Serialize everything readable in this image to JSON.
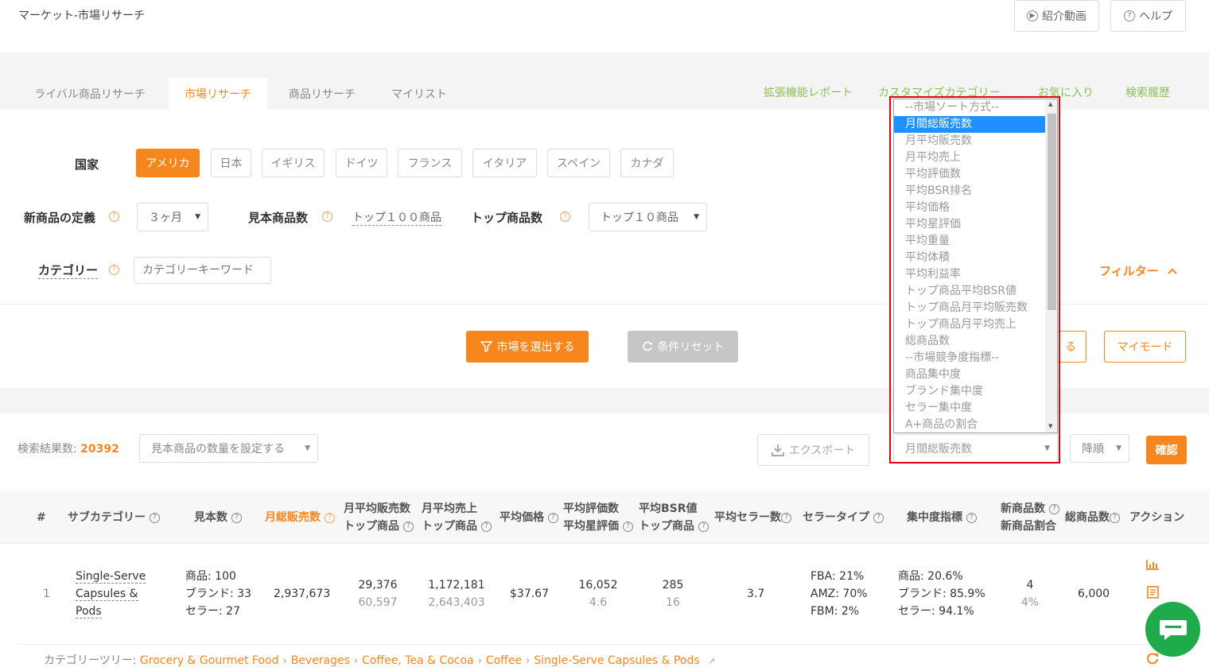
{
  "header": {
    "title": "マーケット-市場リサーチ",
    "intro_video": "紹介動画",
    "help": "ヘルプ"
  },
  "tabs": [
    {
      "label": "ライバル商品リサーチ"
    },
    {
      "label": "市場リサーチ"
    },
    {
      "label": "商品リサーチ"
    },
    {
      "label": "マイリスト"
    }
  ],
  "top_links": [
    "拡張機能レポート",
    "カスタマイズカテゴリー",
    "お気に入り",
    "検索履歴"
  ],
  "filters": {
    "country_label": "国家",
    "countries": [
      "アメリカ",
      "日本",
      "イギリス",
      "ドイツ",
      "フランス",
      "イタリア",
      "スペイン",
      "カナダ"
    ],
    "selected_country": "アメリカ",
    "new_product_label": "新商品の定義",
    "new_product_value": "３ヶ月",
    "sample_count_label": "見本商品数",
    "sample_count_value": "トップ１００商品",
    "top_count_label": "トップ商品数",
    "top_count_value": "トップ１０商品",
    "category_label": "カテゴリー",
    "category_placeholder": "カテゴリーキーワード",
    "filter_toggle": "フィルター",
    "select_button": "市場を選出する",
    "reset_button": "条件リセット",
    "partial_button": "る",
    "my_mode_button": "マイモード"
  },
  "results": {
    "count_label": "検索結果数:",
    "count": "20392",
    "sample_select_placeholder": "見本商品の数量を設定する",
    "export_button": "エクスポート",
    "sort_field_value": "月間総販売数",
    "sort_order_value": "降順",
    "confirm_button": "確認"
  },
  "sort_dropdown": {
    "options": [
      "--市場ソート方式--",
      "月間総販売数",
      "月平均販売数",
      "月平均売上",
      "平均評価数",
      "平均BSR排名",
      "平均価格",
      "平均星評価",
      "平均重量",
      "平均体積",
      "平均利益率",
      "トップ商品平均BSR値",
      "トップ商品月平均販売数",
      "トップ商品月平均売上",
      "総商品数",
      "--市場競争度指標--",
      "商品集中度",
      "ブランド集中度",
      "セラー集中度",
      "A+商品の割合"
    ],
    "highlighted": "月間総販売数"
  },
  "table": {
    "headers": {
      "index": "#",
      "subcategory": "サブカテゴリー",
      "sample": "見本数",
      "monthly_total_sales": "月総販売数",
      "avg_sales_1": "月平均販売数",
      "avg_sales_2": "トップ商品",
      "avg_revenue_1": "月平均売上",
      "avg_revenue_2": "トップ商品",
      "avg_price": "平均価格",
      "avg_reviews_1": "平均評価数",
      "avg_reviews_2": "平均星評価",
      "avg_bsr_1": "平均BSR値",
      "avg_bsr_2": "トップ商品",
      "avg_sellers": "平均セラー数",
      "seller_type": "セラータイプ",
      "concentration": "集中度指標",
      "new_products_1": "新商品数",
      "new_products_2": "新商品割合",
      "total_products": "総商品数",
      "action": "アクション"
    },
    "rows": [
      {
        "index": "1",
        "subcategory_lines": [
          "Single-Serve",
          "Capsules &",
          "Pods"
        ],
        "sample_lines": [
          "商品: 100",
          "ブランド: 33",
          "セラー: 27"
        ],
        "monthly_total_sales": "2,937,673",
        "avg_sales": "29,376",
        "avg_sales_top": "60,597",
        "avg_revenue": "1,172,181",
        "avg_revenue_top": "2,643,403",
        "avg_price": "$37.67",
        "avg_reviews": "16,052",
        "avg_stars": "4.6",
        "avg_bsr": "285",
        "avg_bsr_top": "16",
        "avg_sellers": "3.7",
        "seller_type_lines": [
          "FBA: 21%",
          "AMZ: 70%",
          "FBM: 2%"
        ],
        "concentration_lines": [
          "商品: 20.6%",
          "ブランド: 85.9%",
          "セラー: 94.1%"
        ],
        "new_products": "4",
        "new_products_ratio": "4%",
        "total_products": "6,000"
      }
    ]
  },
  "category_tree": {
    "label": "カテゴリーツリー:",
    "path": [
      "Grocery & Gourmet Food",
      "Beverages",
      "Coffee, Tea & Cocoa",
      "Coffee",
      "Single-Serve Capsules & Pods"
    ]
  },
  "colors": {
    "accent": "#f7861c",
    "link_green": "#8cc152",
    "highlight_blue": "#1e90ff",
    "frame_red": "#e60012",
    "chat_green": "#1faa4b"
  }
}
